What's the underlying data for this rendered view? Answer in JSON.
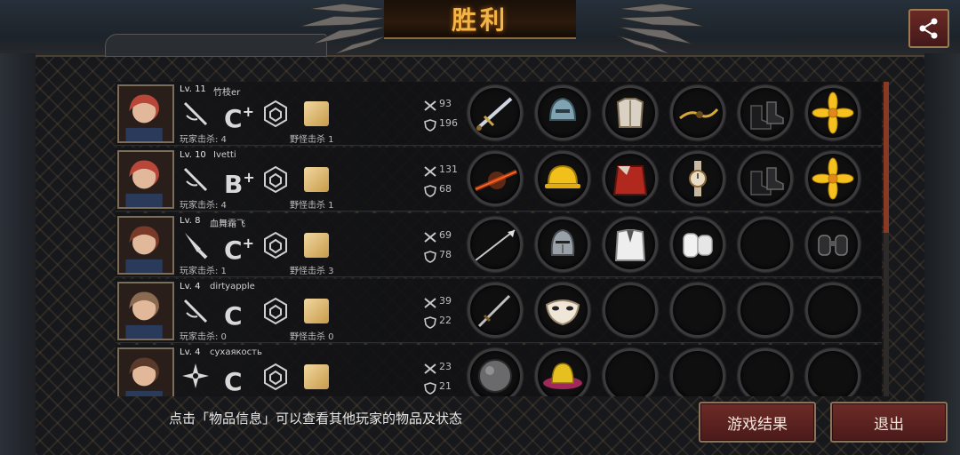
{
  "banner": {
    "title": "胜利"
  },
  "players": [
    {
      "level": "Lv. 11",
      "name": "竹枝er",
      "grade": "C",
      "grade_plus": "+",
      "player_kills": "玩家击杀: 4",
      "monster_kills": "野怪击杀 1",
      "attack": "93",
      "defense": "196",
      "weapon": "rapier-icon",
      "portrait_color": "#b8473a",
      "items": [
        "sword-icon",
        "helmet-icon",
        "armor-icon",
        "gold-chain-icon",
        "boots-icon",
        "flower-icon"
      ]
    },
    {
      "level": "Lv. 10",
      "name": "Ivetti",
      "grade": "B",
      "grade_plus": "+",
      "player_kills": "玩家击杀: 4",
      "monster_kills": "野怪击杀 1",
      "attack": "131",
      "defense": "68",
      "weapon": "rapier-icon",
      "portrait_color": "#b8473a",
      "items": [
        "flame-sword-icon",
        "hardhat-icon",
        "red-cloak-icon",
        "watch-icon",
        "boots-icon",
        "flower-icon"
      ]
    },
    {
      "level": "Lv. 8",
      "name": "血舞霜飞",
      "grade": "C",
      "grade_plus": "+",
      "player_kills": "玩家击杀: 1",
      "monster_kills": "野怪击杀 3",
      "attack": "69",
      "defense": "78",
      "weapon": "knife-icon",
      "portrait_color": "#7a3a2a",
      "items": [
        "spear-icon",
        "knight-helmet-icon",
        "white-suit-icon",
        "bandage-icon",
        "empty",
        "binoculars-icon"
      ]
    },
    {
      "level": "Lv. 4",
      "name": "dirtyapple",
      "grade": "C",
      "grade_plus": "",
      "player_kills": "玩家击杀: 0",
      "monster_kills": "野怪击杀 0",
      "attack": "39",
      "defense": "22",
      "weapon": "rapier-icon",
      "portrait_color": "#8a6a50",
      "items": [
        "dagger-icon",
        "mask-icon",
        "empty",
        "empty",
        "empty",
        "empty"
      ]
    },
    {
      "level": "Lv. 4",
      "name": "сухаякость",
      "grade": "C",
      "grade_plus": "",
      "player_kills": "",
      "monster_kills": "",
      "attack": "23",
      "defense": "21",
      "weapon": "shuriken-icon",
      "portrait_color": "#5a3a2a",
      "items": [
        "iron-ball-icon",
        "hat-icon",
        "empty",
        "empty",
        "empty",
        "empty"
      ]
    }
  ],
  "footer": {
    "hint": "点击「物品信息」可以查看其他玩家的物品及状态",
    "results_button": "游戏结果",
    "exit_button": "退出"
  },
  "colors": {
    "accent": "#f3b447",
    "button": "#6e2b27",
    "scroll": "#8a3a22"
  }
}
